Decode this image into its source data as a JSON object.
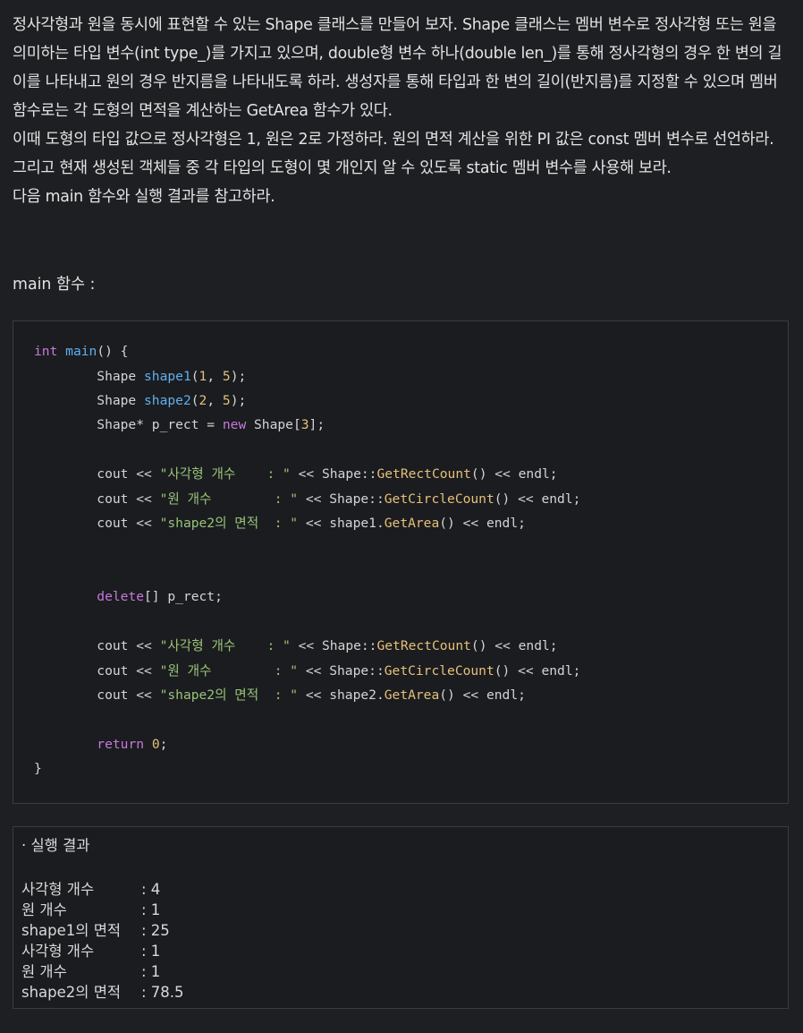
{
  "prose": [
    "정사각형과 원을 동시에 표현할 수 있는 Shape 클래스를 만들어 보자. Shape 클래스는 멤버 변수로 정사각형 또는 원을 의미하는 타입 변수(int type_)를 가지고 있으며, double형 변수 하나(double len_)를 통해 정사각형의 경우 한 변의 길이를 나타내고 원의 경우 반지름을 나타내도록 하라. 생성자를 통해 타입과 한 변의 길이(반지름)를 지정할 수 있으며 멤버 함수로는 각 도형의 면적을 계산하는 GetArea 함수가 있다.",
    "이때 도형의 타입 값으로 정사각형은 1, 원은 2로 가정하라. 원의 면적 계산을 위한 PI 값은 const 멤버 변수로 선언하라. 그리고 현재 생성된 객체들 중 각 타입의 도형이 몇 개인지 알 수 있도록 static 멤버 변수를 사용해 보라.",
    "다음 main 함수와 실행 결과를 참고하라."
  ],
  "main_label": "main 함수 :",
  "code": {
    "l01": [
      [
        "kw",
        "int"
      ],
      [
        "t",
        " "
      ],
      [
        "var",
        "main"
      ],
      [
        "t",
        "() {"
      ]
    ],
    "l02": [
      [
        "t",
        "        Shape "
      ],
      [
        "var",
        "shape1"
      ],
      [
        "t",
        "("
      ],
      [
        "num",
        "1"
      ],
      [
        "t",
        ", "
      ],
      [
        "num",
        "5"
      ],
      [
        "t",
        ");"
      ]
    ],
    "l03": [
      [
        "t",
        "        Shape "
      ],
      [
        "var",
        "shape2"
      ],
      [
        "t",
        "("
      ],
      [
        "num",
        "2"
      ],
      [
        "t",
        ", "
      ],
      [
        "num",
        "5"
      ],
      [
        "t",
        ");"
      ]
    ],
    "l04": [
      [
        "t",
        "        Shape* p_rect = "
      ],
      [
        "kw",
        "new"
      ],
      [
        "t",
        " Shape["
      ],
      [
        "num",
        "3"
      ],
      [
        "t",
        "];"
      ]
    ],
    "l05": [
      [
        "t",
        "        cout << "
      ],
      [
        "str",
        "\"사각형 개수    : \""
      ],
      [
        "t",
        " << Shape::"
      ],
      [
        "fn",
        "GetRectCount"
      ],
      [
        "t",
        "() << endl;"
      ]
    ],
    "l06": [
      [
        "t",
        "        cout << "
      ],
      [
        "str",
        "\"원 개수        : \""
      ],
      [
        "t",
        " << Shape::"
      ],
      [
        "fn",
        "GetCircleCount"
      ],
      [
        "t",
        "() << endl;"
      ]
    ],
    "l07": [
      [
        "t",
        "        cout << "
      ],
      [
        "str",
        "\"shape2의 면적  : \""
      ],
      [
        "t",
        " << shape1."
      ],
      [
        "fn",
        "GetArea"
      ],
      [
        "t",
        "() << endl;"
      ]
    ],
    "l08": [
      [
        "t",
        "        "
      ],
      [
        "kw",
        "delete"
      ],
      [
        "t",
        "[] p_rect;"
      ]
    ],
    "l09": [
      [
        "t",
        "        cout << "
      ],
      [
        "str",
        "\"사각형 개수    : \""
      ],
      [
        "t",
        " << Shape::"
      ],
      [
        "fn",
        "GetRectCount"
      ],
      [
        "t",
        "() << endl;"
      ]
    ],
    "l10": [
      [
        "t",
        "        cout << "
      ],
      [
        "str",
        "\"원 개수        : \""
      ],
      [
        "t",
        " << Shape::"
      ],
      [
        "fn",
        "GetCircleCount"
      ],
      [
        "t",
        "() << endl;"
      ]
    ],
    "l11": [
      [
        "t",
        "        cout << "
      ],
      [
        "str",
        "\"shape2의 면적  : \""
      ],
      [
        "t",
        " << shape2."
      ],
      [
        "fn",
        "GetArea"
      ],
      [
        "t",
        "() << endl;"
      ]
    ],
    "l12": [
      [
        "t",
        "        "
      ],
      [
        "kw",
        "return"
      ],
      [
        "t",
        " "
      ],
      [
        "num",
        "0"
      ],
      [
        "t",
        ";"
      ]
    ],
    "l13": [
      [
        "t",
        "}"
      ]
    ]
  },
  "output": {
    "title": "· 실행 결과",
    "rows": [
      {
        "label": "사각형 개수",
        "value": ": 4"
      },
      {
        "label": "원 개수",
        "value": ": 1"
      },
      {
        "label": "shape1의 면적",
        "value": ": 25"
      },
      {
        "label": "사각형 개수",
        "value": ": 1"
      },
      {
        "label": "원 개수",
        "value": ": 1"
      },
      {
        "label": "shape2의 면적",
        "value": ": 78.5"
      }
    ]
  }
}
